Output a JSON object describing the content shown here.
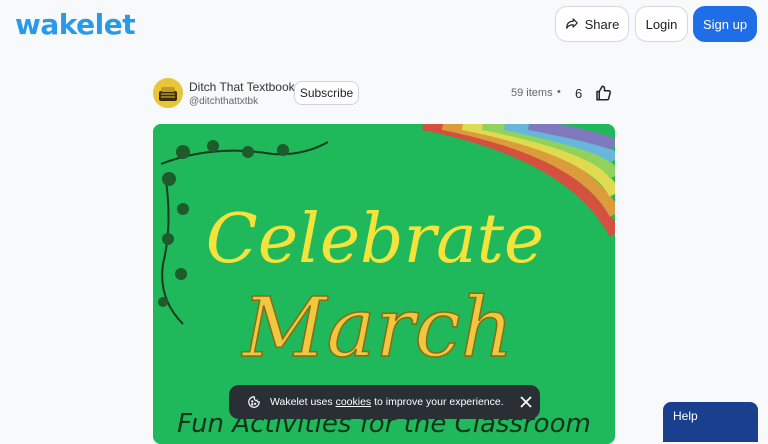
{
  "header": {
    "logo": "wakelet",
    "share_label": "Share",
    "login_label": "Login",
    "signup_label": "Sign up"
  },
  "author": {
    "name": "Ditch That Textbook",
    "handle": "@ditchthattxtbk",
    "subscribe_label": "Subscribe"
  },
  "collection": {
    "items_count": "59 items",
    "separator": "•",
    "likes": "6",
    "cover": {
      "title_line1": "Celebrate",
      "title_line2": "March",
      "subtitle": "Fun Activities for the Classroom"
    }
  },
  "cookie_banner": {
    "prefix": "Wakelet uses",
    "link": "cookies",
    "suffix": "to improve your experience."
  },
  "help": {
    "label": "Help"
  },
  "colors": {
    "brand": "#2a9ae8",
    "primary_button": "#1f6ee8",
    "cover_green": "#1fb85a",
    "title_yellow": "#f3e33a"
  }
}
